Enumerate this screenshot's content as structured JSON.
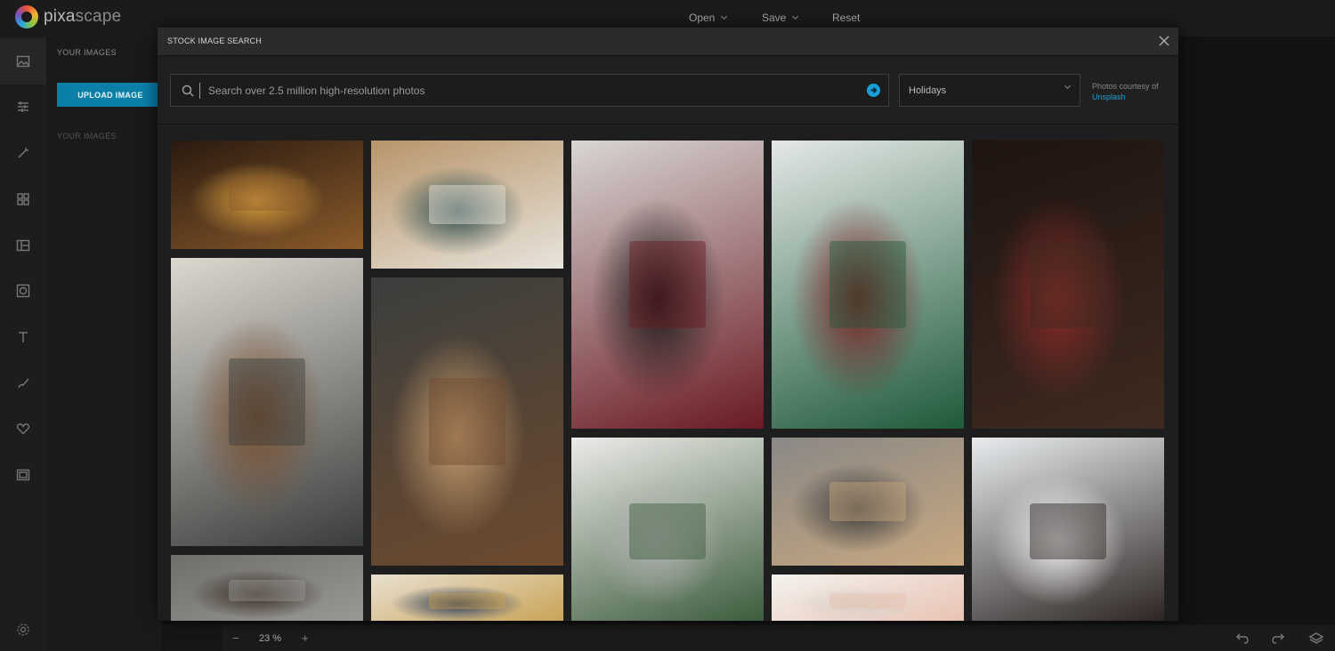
{
  "app": {
    "brand_prefix": "pixa",
    "brand_suffix": "scape",
    "menu": {
      "open": "Open",
      "save": "Save",
      "reset": "Reset"
    }
  },
  "rail": {
    "items": [
      "image-icon",
      "sliders-icon",
      "wand-icon",
      "grid-icon",
      "layout-icon",
      "frame-icon",
      "text-icon",
      "brush-icon",
      "heart-icon",
      "film-icon"
    ],
    "settings": "settings-icon"
  },
  "panel": {
    "title": "YOUR IMAGES",
    "upload_label": "UPLOAD IMAGE",
    "subtitle": "YOUR IMAGES"
  },
  "modal": {
    "title": "STOCK IMAGE SEARCH",
    "search_placeholder": "Search over 2.5 million high-resolution photos",
    "category": "Holidays",
    "courtesy_text": "Photos courtesy of",
    "courtesy_link": "Unsplash"
  },
  "bottom": {
    "zoom_minus": "−",
    "zoom_value": "23 %",
    "zoom_plus": "+"
  },
  "colors": {
    "accent": "#1aa0d8",
    "upload_button": "#0b7fa8",
    "background": "#161616"
  },
  "photos": [
    [
      {
        "desc": "woman-decorating-christmas-tree",
        "colors": [
          "#2a1a10",
          "#8a5a2a",
          "#d9a040"
        ]
      },
      {
        "desc": "two-people-wrapping-gifts-dark-room",
        "colors": [
          "#dcd8d0",
          "#3a3d3c",
          "#7a4e2e"
        ]
      },
      {
        "desc": "man-with-mask-and-lights",
        "colors": [
          "#6e6e6a",
          "#9a9a96",
          "#3a2a22"
        ]
      }
    ],
    [
      {
        "desc": "overhead-laptops-wrapping-paper",
        "colors": [
          "#b8956a",
          "#e8e4dc",
          "#2a4a4a"
        ]
      },
      {
        "desc": "cart-with-laptop-and-gifts",
        "colors": [
          "#3b3e3d",
          "#6e4a2e",
          "#c8a070"
        ]
      },
      {
        "desc": "tablet-gold-ornaments",
        "colors": [
          "#e8e0d0",
          "#c8a050",
          "#2a3a5a"
        ]
      }
    ],
    [
      {
        "desc": "hands-on-tablet-marble-table",
        "colors": [
          "#d8d6d4",
          "#6a1a22",
          "#1a1a1a"
        ]
      },
      {
        "desc": "laughing-person-with-tablet",
        "colors": [
          "#ecebe8",
          "#3a5a3a",
          "#b0b0b0"
        ]
      }
    ],
    [
      {
        "desc": "person-drinking-with-laptop-kitchen",
        "colors": [
          "#e4e8e6",
          "#1e5a3a",
          "#7a1e22"
        ]
      },
      {
        "desc": "couple-wrapping-gifts-by-wall",
        "colors": [
          "#8a8886",
          "#c8a880",
          "#3a3a3a"
        ]
      },
      {
        "desc": "bright-flowers-detail",
        "colors": [
          "#f4f2ee",
          "#e8c0b0",
          "#d8d0c8"
        ]
      }
    ],
    [
      {
        "desc": "dark-christmas-tree-with-gifts",
        "colors": [
          "#1e1410",
          "#3e2a20",
          "#8a2a2a"
        ]
      },
      {
        "desc": "two-friends-laughing-at-laptop",
        "colors": [
          "#e8ecee",
          "#2a2220",
          "#f2f2f2"
        ]
      }
    ]
  ]
}
